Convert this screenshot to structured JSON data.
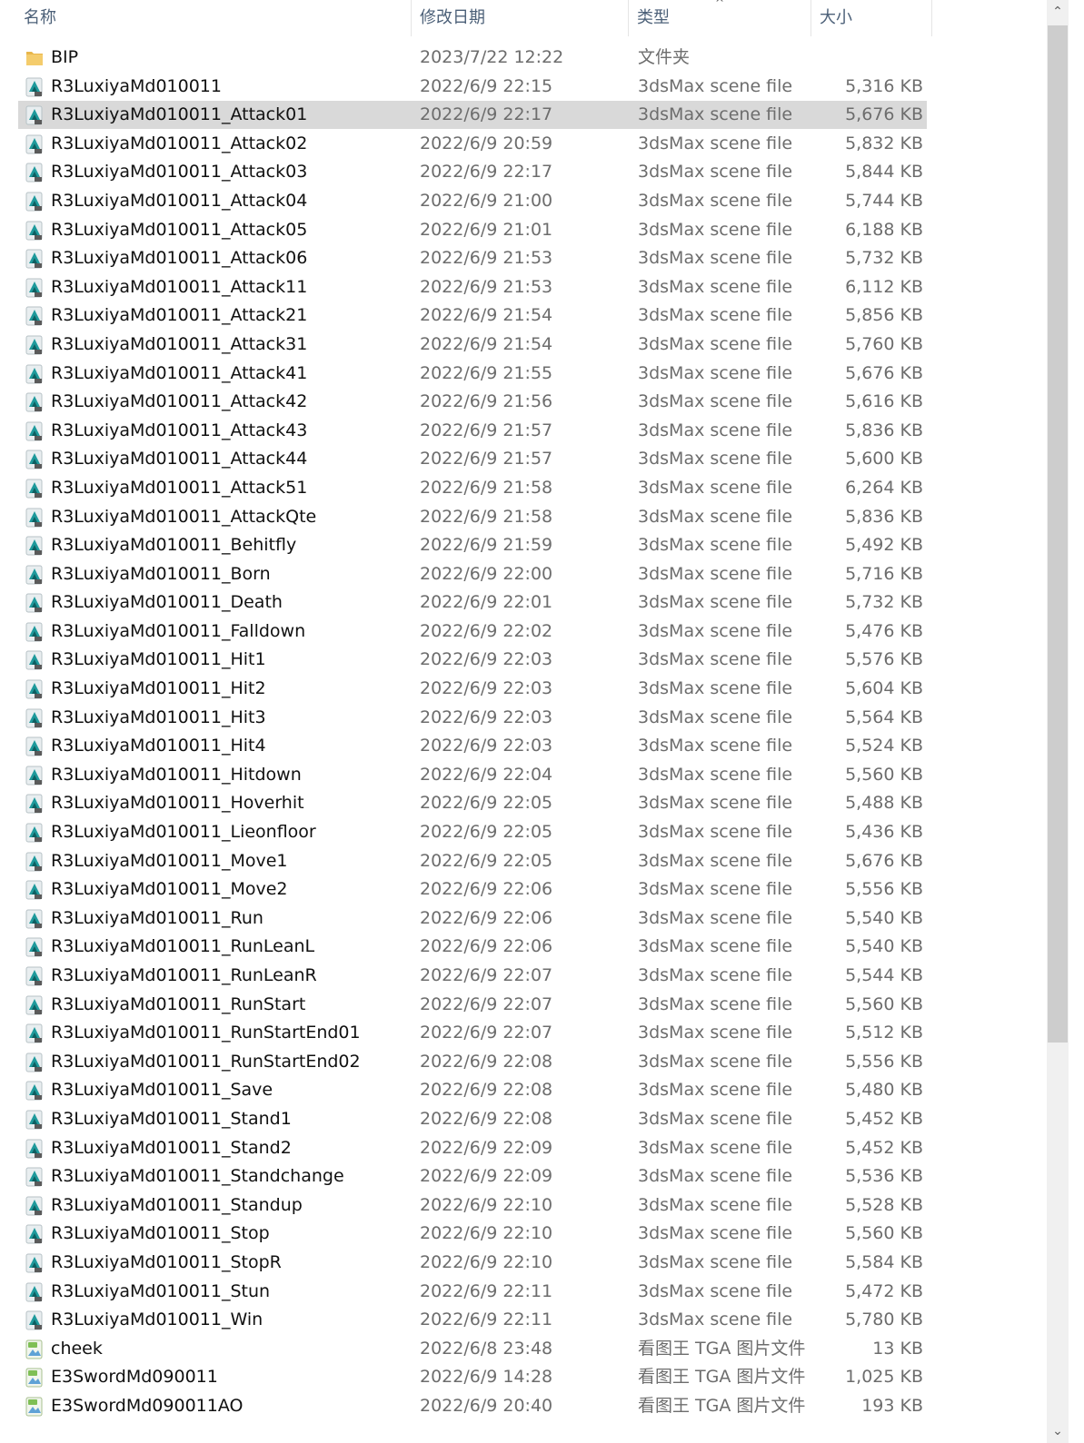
{
  "columns": {
    "name": "名称",
    "date": "修改日期",
    "type": "类型",
    "size": "大小",
    "sort_indicator": "^"
  },
  "colors": {
    "selected_row": "#d9d9d9",
    "header_text": "#4c6078",
    "folder_icon": "#e8b64a",
    "max_icon": "#1f9a9c",
    "tga_icon": "#7fbf55"
  },
  "scrollbar": {
    "up_arrow": "⌃",
    "down_arrow": "⌄"
  },
  "files": [
    {
      "icon": "folder-icon",
      "name": "BIP",
      "date": "2023/7/22 12:22",
      "type": "文件夹",
      "size": ""
    },
    {
      "icon": "max-file-icon",
      "name": "R3LuxiyaMd010011",
      "date": "2022/6/9 22:15",
      "type": "3dsMax scene file",
      "size": "5,316 KB"
    },
    {
      "icon": "max-file-icon",
      "name": "R3LuxiyaMd010011_Attack01",
      "date": "2022/6/9 22:17",
      "type": "3dsMax scene file",
      "size": "5,676 KB",
      "selected": true
    },
    {
      "icon": "max-file-icon",
      "name": "R3LuxiyaMd010011_Attack02",
      "date": "2022/6/9 20:59",
      "type": "3dsMax scene file",
      "size": "5,832 KB"
    },
    {
      "icon": "max-file-icon",
      "name": "R3LuxiyaMd010011_Attack03",
      "date": "2022/6/9 22:17",
      "type": "3dsMax scene file",
      "size": "5,844 KB"
    },
    {
      "icon": "max-file-icon",
      "name": "R3LuxiyaMd010011_Attack04",
      "date": "2022/6/9 21:00",
      "type": "3dsMax scene file",
      "size": "5,744 KB"
    },
    {
      "icon": "max-file-icon",
      "name": "R3LuxiyaMd010011_Attack05",
      "date": "2022/6/9 21:01",
      "type": "3dsMax scene file",
      "size": "6,188 KB"
    },
    {
      "icon": "max-file-icon",
      "name": "R3LuxiyaMd010011_Attack06",
      "date": "2022/6/9 21:53",
      "type": "3dsMax scene file",
      "size": "5,732 KB"
    },
    {
      "icon": "max-file-icon",
      "name": "R3LuxiyaMd010011_Attack11",
      "date": "2022/6/9 21:53",
      "type": "3dsMax scene file",
      "size": "6,112 KB"
    },
    {
      "icon": "max-file-icon",
      "name": "R3LuxiyaMd010011_Attack21",
      "date": "2022/6/9 21:54",
      "type": "3dsMax scene file",
      "size": "5,856 KB"
    },
    {
      "icon": "max-file-icon",
      "name": "R3LuxiyaMd010011_Attack31",
      "date": "2022/6/9 21:54",
      "type": "3dsMax scene file",
      "size": "5,760 KB"
    },
    {
      "icon": "max-file-icon",
      "name": "R3LuxiyaMd010011_Attack41",
      "date": "2022/6/9 21:55",
      "type": "3dsMax scene file",
      "size": "5,676 KB"
    },
    {
      "icon": "max-file-icon",
      "name": "R3LuxiyaMd010011_Attack42",
      "date": "2022/6/9 21:56",
      "type": "3dsMax scene file",
      "size": "5,616 KB"
    },
    {
      "icon": "max-file-icon",
      "name": "R3LuxiyaMd010011_Attack43",
      "date": "2022/6/9 21:57",
      "type": "3dsMax scene file",
      "size": "5,836 KB"
    },
    {
      "icon": "max-file-icon",
      "name": "R3LuxiyaMd010011_Attack44",
      "date": "2022/6/9 21:57",
      "type": "3dsMax scene file",
      "size": "5,600 KB"
    },
    {
      "icon": "max-file-icon",
      "name": "R3LuxiyaMd010011_Attack51",
      "date": "2022/6/9 21:58",
      "type": "3dsMax scene file",
      "size": "6,264 KB"
    },
    {
      "icon": "max-file-icon",
      "name": "R3LuxiyaMd010011_AttackQte",
      "date": "2022/6/9 21:58",
      "type": "3dsMax scene file",
      "size": "5,836 KB"
    },
    {
      "icon": "max-file-icon",
      "name": "R3LuxiyaMd010011_Behitfly",
      "date": "2022/6/9 21:59",
      "type": "3dsMax scene file",
      "size": "5,492 KB"
    },
    {
      "icon": "max-file-icon",
      "name": "R3LuxiyaMd010011_Born",
      "date": "2022/6/9 22:00",
      "type": "3dsMax scene file",
      "size": "5,716 KB"
    },
    {
      "icon": "max-file-icon",
      "name": "R3LuxiyaMd010011_Death",
      "date": "2022/6/9 22:01",
      "type": "3dsMax scene file",
      "size": "5,732 KB"
    },
    {
      "icon": "max-file-icon",
      "name": "R3LuxiyaMd010011_Falldown",
      "date": "2022/6/9 22:02",
      "type": "3dsMax scene file",
      "size": "5,476 KB"
    },
    {
      "icon": "max-file-icon",
      "name": "R3LuxiyaMd010011_Hit1",
      "date": "2022/6/9 22:03",
      "type": "3dsMax scene file",
      "size": "5,576 KB"
    },
    {
      "icon": "max-file-icon",
      "name": "R3LuxiyaMd010011_Hit2",
      "date": "2022/6/9 22:03",
      "type": "3dsMax scene file",
      "size": "5,604 KB"
    },
    {
      "icon": "max-file-icon",
      "name": "R3LuxiyaMd010011_Hit3",
      "date": "2022/6/9 22:03",
      "type": "3dsMax scene file",
      "size": "5,564 KB"
    },
    {
      "icon": "max-file-icon",
      "name": "R3LuxiyaMd010011_Hit4",
      "date": "2022/6/9 22:03",
      "type": "3dsMax scene file",
      "size": "5,524 KB"
    },
    {
      "icon": "max-file-icon",
      "name": "R3LuxiyaMd010011_Hitdown",
      "date": "2022/6/9 22:04",
      "type": "3dsMax scene file",
      "size": "5,560 KB"
    },
    {
      "icon": "max-file-icon",
      "name": "R3LuxiyaMd010011_Hoverhit",
      "date": "2022/6/9 22:05",
      "type": "3dsMax scene file",
      "size": "5,488 KB"
    },
    {
      "icon": "max-file-icon",
      "name": "R3LuxiyaMd010011_Lieonfloor",
      "date": "2022/6/9 22:05",
      "type": "3dsMax scene file",
      "size": "5,436 KB"
    },
    {
      "icon": "max-file-icon",
      "name": "R3LuxiyaMd010011_Move1",
      "date": "2022/6/9 22:05",
      "type": "3dsMax scene file",
      "size": "5,676 KB"
    },
    {
      "icon": "max-file-icon",
      "name": "R3LuxiyaMd010011_Move2",
      "date": "2022/6/9 22:06",
      "type": "3dsMax scene file",
      "size": "5,556 KB"
    },
    {
      "icon": "max-file-icon",
      "name": "R3LuxiyaMd010011_Run",
      "date": "2022/6/9 22:06",
      "type": "3dsMax scene file",
      "size": "5,540 KB"
    },
    {
      "icon": "max-file-icon",
      "name": "R3LuxiyaMd010011_RunLeanL",
      "date": "2022/6/9 22:06",
      "type": "3dsMax scene file",
      "size": "5,540 KB"
    },
    {
      "icon": "max-file-icon",
      "name": "R3LuxiyaMd010011_RunLeanR",
      "date": "2022/6/9 22:07",
      "type": "3dsMax scene file",
      "size": "5,544 KB"
    },
    {
      "icon": "max-file-icon",
      "name": "R3LuxiyaMd010011_RunStart",
      "date": "2022/6/9 22:07",
      "type": "3dsMax scene file",
      "size": "5,560 KB"
    },
    {
      "icon": "max-file-icon",
      "name": "R3LuxiyaMd010011_RunStartEnd01",
      "date": "2022/6/9 22:07",
      "type": "3dsMax scene file",
      "size": "5,512 KB"
    },
    {
      "icon": "max-file-icon",
      "name": "R3LuxiyaMd010011_RunStartEnd02",
      "date": "2022/6/9 22:08",
      "type": "3dsMax scene file",
      "size": "5,556 KB"
    },
    {
      "icon": "max-file-icon",
      "name": "R3LuxiyaMd010011_Save",
      "date": "2022/6/9 22:08",
      "type": "3dsMax scene file",
      "size": "5,480 KB"
    },
    {
      "icon": "max-file-icon",
      "name": "R3LuxiyaMd010011_Stand1",
      "date": "2022/6/9 22:08",
      "type": "3dsMax scene file",
      "size": "5,452 KB"
    },
    {
      "icon": "max-file-icon",
      "name": "R3LuxiyaMd010011_Stand2",
      "date": "2022/6/9 22:09",
      "type": "3dsMax scene file",
      "size": "5,452 KB"
    },
    {
      "icon": "max-file-icon",
      "name": "R3LuxiyaMd010011_Standchange",
      "date": "2022/6/9 22:09",
      "type": "3dsMax scene file",
      "size": "5,536 KB"
    },
    {
      "icon": "max-file-icon",
      "name": "R3LuxiyaMd010011_Standup",
      "date": "2022/6/9 22:10",
      "type": "3dsMax scene file",
      "size": "5,528 KB"
    },
    {
      "icon": "max-file-icon",
      "name": "R3LuxiyaMd010011_Stop",
      "date": "2022/6/9 22:10",
      "type": "3dsMax scene file",
      "size": "5,560 KB"
    },
    {
      "icon": "max-file-icon",
      "name": "R3LuxiyaMd010011_StopR",
      "date": "2022/6/9 22:10",
      "type": "3dsMax scene file",
      "size": "5,584 KB"
    },
    {
      "icon": "max-file-icon",
      "name": "R3LuxiyaMd010011_Stun",
      "date": "2022/6/9 22:11",
      "type": "3dsMax scene file",
      "size": "5,472 KB"
    },
    {
      "icon": "max-file-icon",
      "name": "R3LuxiyaMd010011_Win",
      "date": "2022/6/9 22:11",
      "type": "3dsMax scene file",
      "size": "5,780 KB"
    },
    {
      "icon": "tga-image-icon",
      "name": "cheek",
      "date": "2022/6/8 23:48",
      "type": "看图王 TGA 图片文件",
      "size": "13 KB"
    },
    {
      "icon": "tga-image-icon",
      "name": "E3SwordMd090011",
      "date": "2022/6/9 14:28",
      "type": "看图王 TGA 图片文件",
      "size": "1,025 KB"
    },
    {
      "icon": "tga-image-icon",
      "name": "E3SwordMd090011AO",
      "date": "2022/6/9 20:40",
      "type": "看图王 TGA 图片文件",
      "size": "193 KB"
    }
  ]
}
